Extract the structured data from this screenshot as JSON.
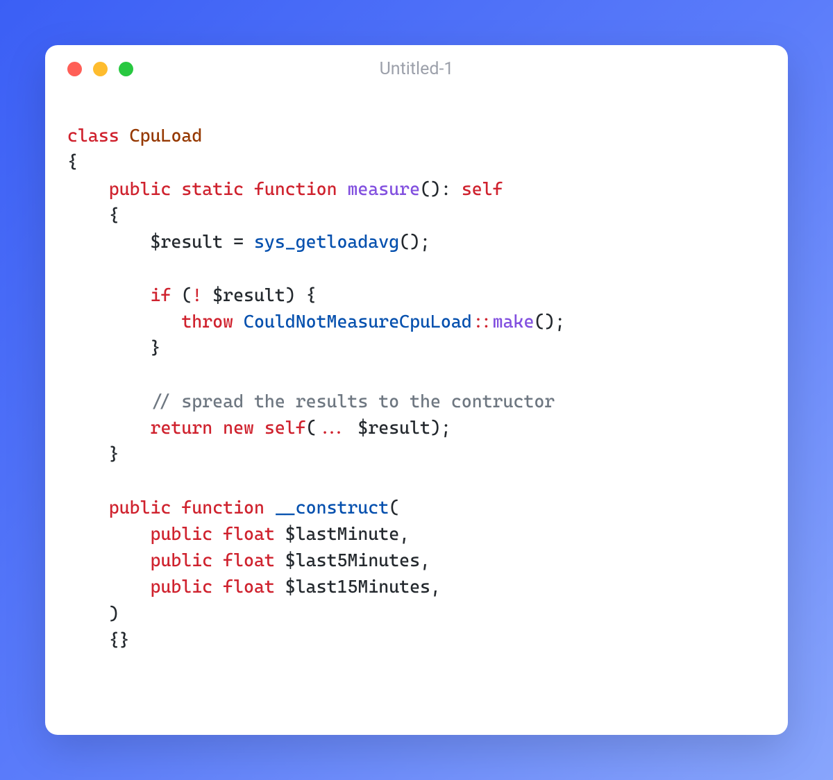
{
  "window": {
    "title": "Untitled-1"
  },
  "traffic_lights": {
    "close": "close",
    "minimize": "minimize",
    "maximize": "maximize"
  },
  "code": {
    "l1_class": "class",
    "l1_name": "CpuLoad",
    "l2_open": "{",
    "l3_public": "public",
    "l3_static": "static",
    "l3_function": "function",
    "l3_measure": "measure",
    "l3_parens": "():",
    "l3_self": "self",
    "l4_open": "{",
    "l5_result": "$result",
    "l5_eq": " = ",
    "l5_sys": "sys_getloadavg",
    "l5_parens": "();",
    "l7_if": "if",
    "l7_open": " (",
    "l7_not": "!",
    "l7_result": " $result) {",
    "l8_throw": "throw",
    "l8_exc": " CouldNotMeasureCpuLoad",
    "l8_scope": "::",
    "l8_make": "make",
    "l8_parens": "();",
    "l9_close": "}",
    "l11_comment": "// spread the results to the contructor",
    "l12_return": "return",
    "l12_new": "new",
    "l12_self": "self",
    "l12_open": "(",
    "l12_spread": "...",
    "l12_result": " $result);",
    "l13_close": "}",
    "l15_public": "public",
    "l15_function": "function",
    "l15_construct": "__construct",
    "l15_open": "(",
    "l16_public": "public",
    "l16_float": "float",
    "l16_var": " $lastMinute,",
    "l17_public": "public",
    "l17_float": "float",
    "l17_var": " $last5Minutes,",
    "l18_public": "public",
    "l18_float": "float",
    "l18_var": " $last15Minutes,",
    "l19_close": ")",
    "l20_body": "{}"
  }
}
